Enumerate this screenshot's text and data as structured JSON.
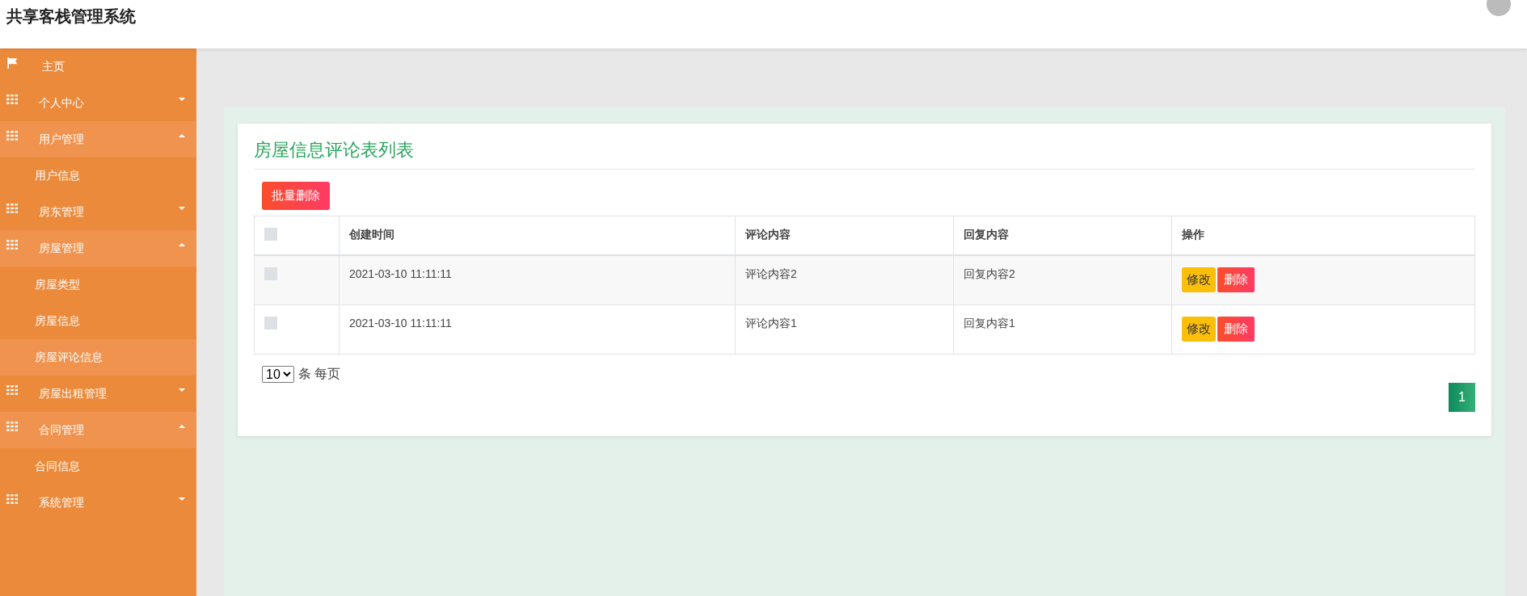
{
  "header": {
    "title": "共享客栈管理系统"
  },
  "sidebar": {
    "items": [
      {
        "label": "主页",
        "kind": "link"
      },
      {
        "label": "个人中心",
        "kind": "group",
        "expanded": false
      },
      {
        "label": "用户管理",
        "kind": "group",
        "expanded": true,
        "children": [
          {
            "label": "用户信息",
            "selected": false
          }
        ]
      },
      {
        "label": "房东管理",
        "kind": "group",
        "expanded": false
      },
      {
        "label": "房屋管理",
        "kind": "group",
        "expanded": true,
        "children": [
          {
            "label": "房屋类型",
            "selected": false
          },
          {
            "label": "房屋信息",
            "selected": false
          },
          {
            "label": "房屋评论信息",
            "selected": true
          }
        ]
      },
      {
        "label": "房屋出租管理",
        "kind": "group",
        "expanded": false
      },
      {
        "label": "合同管理",
        "kind": "group",
        "expanded": true,
        "children": [
          {
            "label": "合同信息",
            "selected": false
          }
        ]
      },
      {
        "label": "系统管理",
        "kind": "group",
        "expanded": false
      }
    ]
  },
  "card": {
    "title": "房屋信息评论表列表",
    "bulk_delete": "批量删除"
  },
  "table": {
    "columns": [
      "创建时间",
      "评论内容",
      "回复内容",
      "操作"
    ],
    "header_checked": false,
    "rows": [
      {
        "checked": false,
        "created": "2021-03-10 11:11:11",
        "comment": "评论内容2",
        "reply": "回复内容2",
        "edit": "修改",
        "delete": "删除"
      },
      {
        "checked": false,
        "created": "2021-03-10 11:11:11",
        "comment": "评论内容1",
        "reply": "回复内容1",
        "edit": "修改",
        "delete": "删除"
      }
    ]
  },
  "pager": {
    "page_size": "10",
    "per_page_label": "条 每页",
    "pages": [
      {
        "label": "1",
        "selected": true
      }
    ]
  }
}
